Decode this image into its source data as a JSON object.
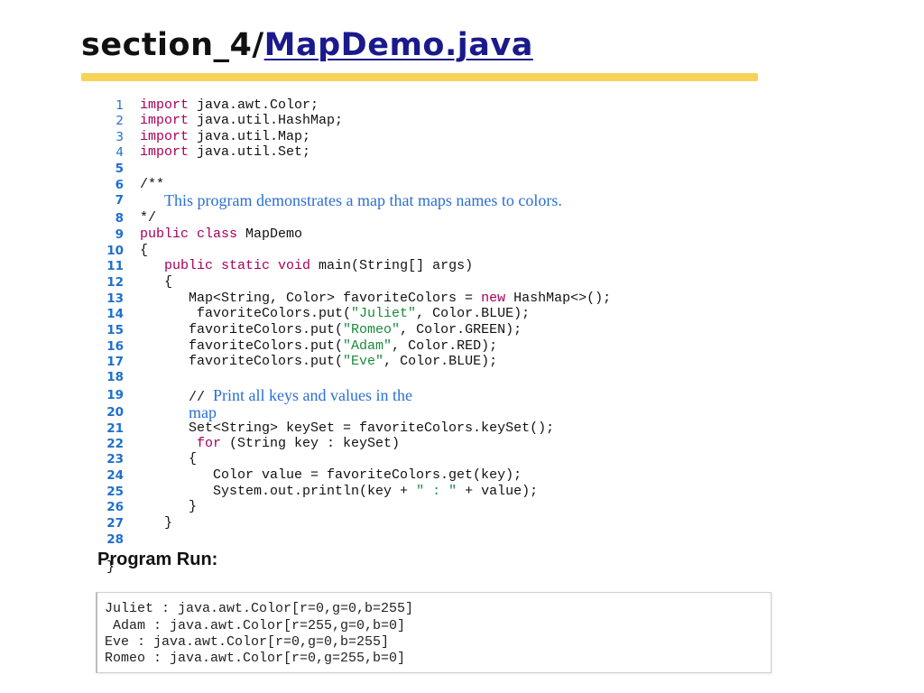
{
  "title": {
    "prefix": "section_4/",
    "link": "MapDemo.java"
  },
  "code_lines": [
    {
      "num": "1",
      "parts": [
        {
          "t": "import",
          "c": "k"
        },
        {
          "t": " java.awt.Color;",
          "c": "n"
        }
      ]
    },
    {
      "num": "2",
      "parts": [
        {
          "t": "import",
          "c": "k"
        },
        {
          "t": " java.util.HashMap;",
          "c": "n"
        }
      ]
    },
    {
      "num": "3",
      "parts": [
        {
          "t": "import",
          "c": "k"
        },
        {
          "t": " java.util.Map;",
          "c": "n"
        }
      ]
    },
    {
      "num": "4",
      "parts": [
        {
          "t": "import",
          "c": "k"
        },
        {
          "t": " java.util.Set;",
          "c": "n"
        }
      ]
    },
    {
      "num": "5",
      "parts": []
    },
    {
      "num": "6",
      "parts": [
        {
          "t": "/**",
          "c": "c"
        }
      ]
    },
    {
      "num": "7",
      "parts": [
        {
          "t": "   ",
          "c": "n"
        },
        {
          "t": "This program demonstrates a map that maps names to colors.",
          "c": "t"
        }
      ]
    },
    {
      "num": "8",
      "parts": [
        {
          "t": "*/",
          "c": "c"
        }
      ]
    },
    {
      "num": "9",
      "parts": [
        {
          "t": "public class",
          "c": "k"
        },
        {
          "t": " MapDemo",
          "c": "n"
        }
      ]
    },
    {
      "num": "10",
      "parts": [
        {
          "t": "{",
          "c": "n"
        }
      ]
    },
    {
      "num": "11",
      "parts": [
        {
          "t": "   ",
          "c": "n"
        },
        {
          "t": "public static void",
          "c": "k"
        },
        {
          "t": " main(String[] args)",
          "c": "n"
        }
      ]
    },
    {
      "num": "12",
      "parts": [
        {
          "t": "   {",
          "c": "n"
        }
      ]
    },
    {
      "num": "13",
      "parts": [
        {
          "t": "      Map<String, Color> favoriteColors = ",
          "c": "n"
        },
        {
          "t": "new",
          "c": "k"
        },
        {
          "t": " HashMap<>();",
          "c": "n"
        }
      ]
    },
    {
      "num": "14",
      "parts": [
        {
          "t": "       favoriteColors.put(",
          "c": "n"
        },
        {
          "t": "\"Juliet\"",
          "c": "s"
        },
        {
          "t": ", Color.BLUE);",
          "c": "n"
        }
      ]
    },
    {
      "num": "15",
      "parts": [
        {
          "t": "      favoriteColors.put(",
          "c": "n"
        },
        {
          "t": "\"Romeo\"",
          "c": "s"
        },
        {
          "t": ", Color.GREEN);",
          "c": "n"
        }
      ]
    },
    {
      "num": "16",
      "parts": [
        {
          "t": "      favoriteColors.put(",
          "c": "n"
        },
        {
          "t": "\"Adam\"",
          "c": "s"
        },
        {
          "t": ", Color.RED);",
          "c": "n"
        }
      ]
    },
    {
      "num": "17",
      "parts": [
        {
          "t": "      favoriteColors.put(",
          "c": "n"
        },
        {
          "t": "\"Eve\"",
          "c": "s"
        },
        {
          "t": ", Color.BLUE);",
          "c": "n"
        }
      ]
    },
    {
      "num": "18",
      "parts": []
    },
    {
      "num": "19",
      "parts": [
        {
          "t": "      // ",
          "c": "c"
        },
        {
          "t": "Print all keys and values in the",
          "c": "t"
        }
      ]
    },
    {
      "num": "20",
      "parts": [
        {
          "t": "      ",
          "c": "n"
        },
        {
          "t": "map",
          "c": "t"
        }
      ]
    },
    {
      "num": "21",
      "parts": [
        {
          "t": "      Set<String> keySet = favoriteColors.keySet();",
          "c": "n"
        }
      ]
    },
    {
      "num": "22",
      "parts": [
        {
          "t": "       ",
          "c": "n"
        },
        {
          "t": "for",
          "c": "k"
        },
        {
          "t": " (String key : keySet)",
          "c": "n"
        }
      ]
    },
    {
      "num": "23",
      "parts": [
        {
          "t": "      {",
          "c": "n"
        }
      ]
    },
    {
      "num": "24",
      "parts": [
        {
          "t": "         Color value = favoriteColors.get(key);",
          "c": "n"
        }
      ]
    },
    {
      "num": "25",
      "parts": [
        {
          "t": "         System.out.println(key + ",
          "c": "n"
        },
        {
          "t": "\" : \"",
          "c": "s"
        },
        {
          "t": " + value);",
          "c": "n"
        }
      ]
    },
    {
      "num": "26",
      "parts": [
        {
          "t": "      }",
          "c": "n"
        }
      ]
    },
    {
      "num": "27",
      "parts": [
        {
          "t": "   }",
          "c": "n"
        }
      ]
    },
    {
      "num": "28",
      "parts": []
    },
    {
      "num": "",
      "parts": [
        {
          "t": "}",
          "c": "n"
        }
      ]
    }
  ],
  "program_run": {
    "heading": "Program Run:",
    "output": [
      "Juliet : java.awt.Color[r=0,g=0,b=255]",
      " Adam : java.awt.Color[r=255,g=0,b=0]",
      "Eve : java.awt.Color[r=0,g=0,b=255]",
      "Romeo : java.awt.Color[r=0,g=255,b=0]"
    ]
  }
}
